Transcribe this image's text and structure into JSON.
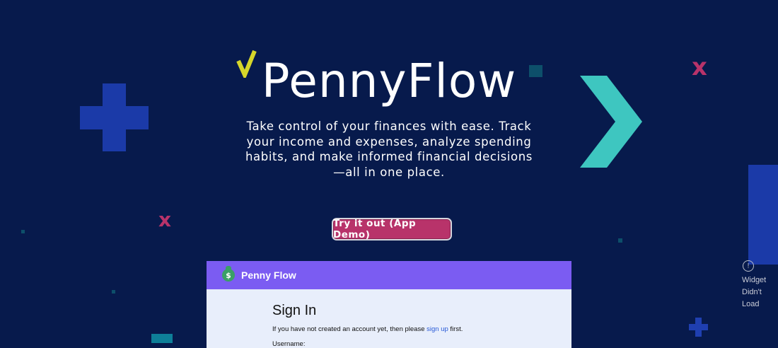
{
  "hero": {
    "brand_title": "PennyFlow",
    "description": "Take control of your finances with ease. Track your income and expenses, analyze spending habits, and make informed financial decisions—all in one place.",
    "cta_label": "Try it out (App Demo)"
  },
  "decorations": {
    "x_mark": "x"
  },
  "app_preview": {
    "brand": "Penny Flow",
    "logo_glyph": "$",
    "signin_title": "Sign In",
    "note_before": "If you have not created an account yet, then please",
    "note_link": "sign up",
    "note_after": "first.",
    "username_label": "Username:"
  },
  "widget": {
    "icon_glyph": "!",
    "line1": "Widget",
    "line2": "Didn't",
    "line3": "Load"
  },
  "colors": {
    "background": "#071a4c",
    "accent_pink": "#b8336a",
    "accent_teal": "#3ec6c0",
    "accent_yellow": "#d6d62a",
    "app_bar": "#7b5cf2"
  }
}
